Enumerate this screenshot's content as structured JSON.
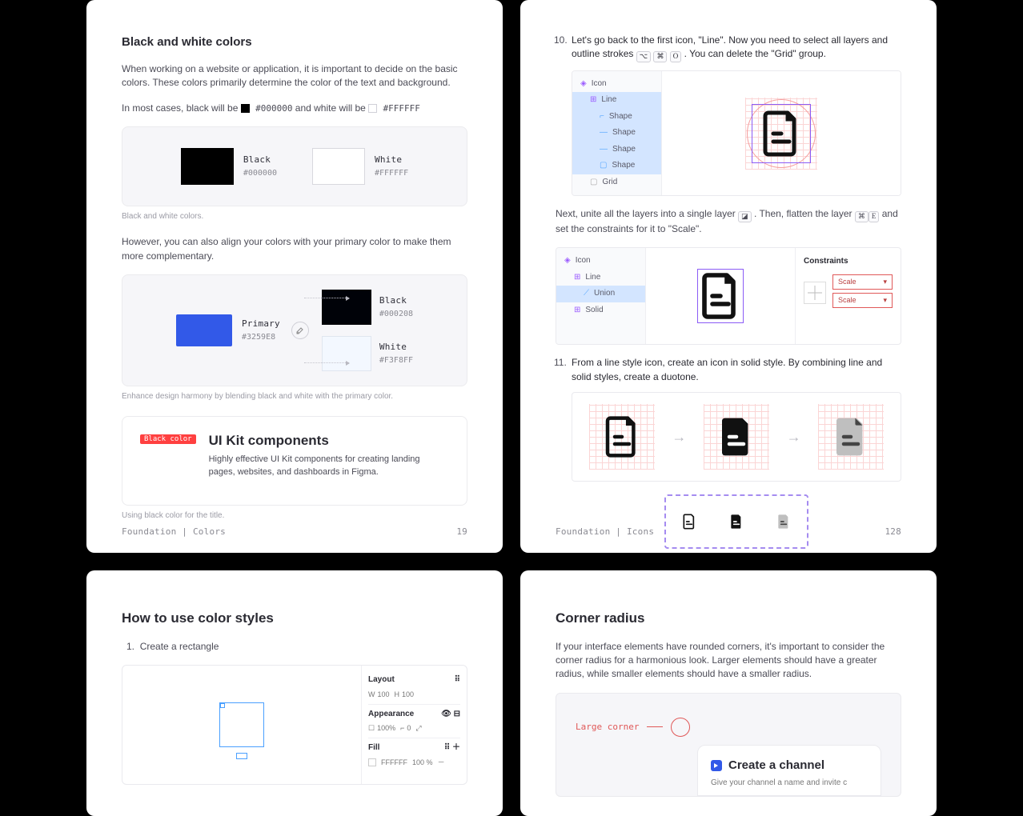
{
  "cards": {
    "bwColors": {
      "heading": "Black and white colors",
      "intro": "When working on a website or application, it is important to decide on the basic colors. These colors primarily determine the color of the text and background.",
      "line2a": "In most cases, black will be",
      "line2b": "and white will be",
      "code_black": "#000000",
      "code_white": "#FFFFFF",
      "swatch": {
        "black_name": "Black",
        "black_hex": "#000000",
        "white_name": "White",
        "white_hex": "#FFFFFF"
      },
      "caption1": "Black and white colors.",
      "line3": "However, you can also align your colors with your primary color to make them more complementary.",
      "primary": {
        "name": "Primary",
        "hex": "#3259E8"
      },
      "blend_black": {
        "name": "Black",
        "hex": "#000208"
      },
      "blend_white": {
        "name": "White",
        "hex": "#F3F8FF"
      },
      "caption2": "Enhance design harmony by blending black and white with the primary color.",
      "kit": {
        "tag": "Black color",
        "title": "UI Kit components",
        "desc": "Highly effective UI Kit components for creating landing pages, websites, and dashboards in Figma."
      },
      "caption3": "Using black color for the title.",
      "footer_l": "Foundation  |  Colors",
      "footer_r": "19"
    },
    "icons": {
      "step10": "Let's go back to the first icon, \"Line\". Now you need to select all layers and outline strokes",
      "step10b": ". You can delete the \"Grid\" group.",
      "kbd10": [
        "⌥",
        "⌘",
        "O"
      ],
      "layers1": [
        "Icon",
        "Line",
        "Shape",
        "Shape",
        "Shape",
        "Shape",
        "Grid"
      ],
      "midline": "Next, unite all the layers into a single layer",
      "midline2": ". Then, flatten the layer",
      "midline3": "and set the constraints for it to \"Scale\".",
      "layers2": [
        "Icon",
        "Line",
        "Union",
        "Solid"
      ],
      "constraints_title": "Constraints",
      "scale": "Scale",
      "step11": "From a line style icon, create an icon in solid style. By combining line and solid styles, create a duotone.",
      "footer_l": "Foundation  |  Icons",
      "footer_r": "128"
    },
    "styles": {
      "heading": "How to use color styles",
      "step1": "Create a rectangle",
      "rect_label": "100 × 100",
      "inspector": {
        "layout": "Layout",
        "w": "100",
        "h": "100",
        "appearance": "Appearance",
        "opacity": "100%",
        "radius": "0",
        "fill": "Fill",
        "fill_val": "FFFFFF",
        "fill_pct": "100",
        "pct": "%"
      }
    },
    "corner": {
      "heading": "Corner radius",
      "intro": "If your interface elements have rounded corners, it's important to consider the corner radius for a harmonious look. Larger elements should have a greater radius, while smaller elements should have a smaller radius.",
      "callout": "Large corner",
      "card_title": "Create a channel",
      "card_desc": "Give your channel a name and invite c"
    }
  }
}
